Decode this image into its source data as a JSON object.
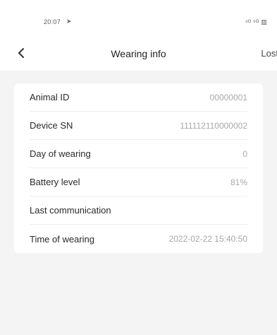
{
  "status_bar": {
    "time": "20:07",
    "nav_symbol": "➤",
    "icons_text": "⁴ᴳ ⁵ᴳ ▥"
  },
  "header": {
    "title": "Wearing info",
    "right_action": "Lost",
    "back_icon": "chevron-left-icon"
  },
  "info": {
    "rows": [
      {
        "label": "Animal ID",
        "value": "00000001"
      },
      {
        "label": "Device SN",
        "value": "111112110000002"
      },
      {
        "label": "Day of wearing",
        "value": "0"
      },
      {
        "label": "Battery level",
        "value": "81%"
      },
      {
        "label": "Last communication",
        "value": ""
      },
      {
        "label": "Time of wearing",
        "value": "2022-02-22 15:40:50"
      }
    ]
  }
}
